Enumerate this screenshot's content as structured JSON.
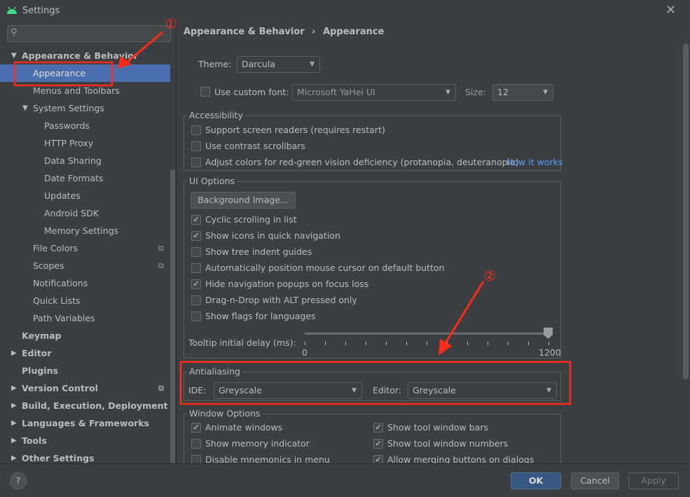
{
  "window": {
    "title": "Settings",
    "close": "✕"
  },
  "colors": {
    "accent": "#4b6eaf",
    "ok": "#365880",
    "link": "#589df6",
    "annotation": "#ff2a1a"
  },
  "sidebar": {
    "items": [
      {
        "label": "Appearance & Behavior",
        "level": 0,
        "bold": true,
        "arrow": "▼"
      },
      {
        "label": "Appearance",
        "level": 1,
        "selected": true
      },
      {
        "label": "Menus and Toolbars",
        "level": 1
      },
      {
        "label": "System Settings",
        "level": 1,
        "arrow": "▼"
      },
      {
        "label": "Passwords",
        "level": 2
      },
      {
        "label": "HTTP Proxy",
        "level": 2
      },
      {
        "label": "Data Sharing",
        "level": 2
      },
      {
        "label": "Date Formats",
        "level": 2
      },
      {
        "label": "Updates",
        "level": 2
      },
      {
        "label": "Android SDK",
        "level": 2
      },
      {
        "label": "Memory Settings",
        "level": 2
      },
      {
        "label": "File Colors",
        "level": 1,
        "icon": "copy-icon"
      },
      {
        "label": "Scopes",
        "level": 1,
        "icon": "copy-icon"
      },
      {
        "label": "Notifications",
        "level": 1
      },
      {
        "label": "Quick Lists",
        "level": 1
      },
      {
        "label": "Path Variables",
        "level": 1
      },
      {
        "label": "Keymap",
        "level": 0,
        "bold": true
      },
      {
        "label": "Editor",
        "level": 0,
        "bold": true,
        "arrow": "▶"
      },
      {
        "label": "Plugins",
        "level": 0,
        "bold": true
      },
      {
        "label": "Version Control",
        "level": 0,
        "bold": true,
        "arrow": "▶",
        "icon": "copy-icon"
      },
      {
        "label": "Build, Execution, Deployment",
        "level": 0,
        "bold": true,
        "arrow": "▶"
      },
      {
        "label": "Languages & Frameworks",
        "level": 0,
        "bold": true,
        "arrow": "▶"
      },
      {
        "label": "Tools",
        "level": 0,
        "bold": true,
        "arrow": "▶"
      },
      {
        "label": "Other Settings",
        "level": 0,
        "bold": true,
        "arrow": "▶"
      }
    ]
  },
  "main": {
    "breadcrumb": [
      "Appearance & Behavior",
      "›",
      "Appearance"
    ],
    "theme_label": "Theme:",
    "theme_value": "Darcula",
    "custom_font_label": "Use custom font:",
    "custom_font_checked": false,
    "font_value": "Microsoft YaHei UI",
    "size_label": "Size:",
    "size_value": "12",
    "accessibility": {
      "title": "Accessibility",
      "items": [
        {
          "label": "Support screen readers (requires restart)",
          "checked": false
        },
        {
          "label": "Use contrast scrollbars",
          "checked": false
        },
        {
          "label": "Adjust colors for red-green vision deficiency (protanopia, deuteranopia)",
          "checked": false
        }
      ],
      "link": "How it works"
    },
    "ui_options": {
      "title": "UI Options",
      "bg_button": "Background Image...",
      "items": [
        {
          "label": "Cyclic scrolling in list",
          "checked": true
        },
        {
          "label": "Show icons in quick navigation",
          "checked": true
        },
        {
          "label": "Show tree indent guides",
          "checked": false
        },
        {
          "label": "Automatically position mouse cursor on default button",
          "checked": false
        },
        {
          "label": "Hide navigation popups on focus loss",
          "checked": true
        },
        {
          "label": "Drag-n-Drop with ALT pressed only",
          "checked": false
        },
        {
          "label": "Show flags for languages",
          "checked": false
        }
      ],
      "tooltip_label": "Tooltip initial delay (ms):",
      "slider_min": "0",
      "slider_max": "1200",
      "slider_value": 1200
    },
    "antialiasing": {
      "title": "Antialiasing",
      "ide_label": "IDE:",
      "ide_value": "Greyscale",
      "editor_label": "Editor:",
      "editor_value": "Greyscale"
    },
    "window_options": {
      "title": "Window Options",
      "left": [
        {
          "label": "Animate windows",
          "checked": true
        },
        {
          "label": "Show memory indicator",
          "checked": false
        },
        {
          "label": "Disable mnemonics in menu",
          "checked": false
        }
      ],
      "right": [
        {
          "label": "Show tool window bars",
          "checked": true
        },
        {
          "label": "Show tool window numbers",
          "checked": true
        },
        {
          "label": "Allow merging buttons on dialogs",
          "checked": true
        }
      ]
    }
  },
  "footer": {
    "help": "?",
    "ok": "OK",
    "cancel": "Cancel",
    "apply": "Apply"
  },
  "annotations": {
    "one": "①",
    "two": "②"
  }
}
